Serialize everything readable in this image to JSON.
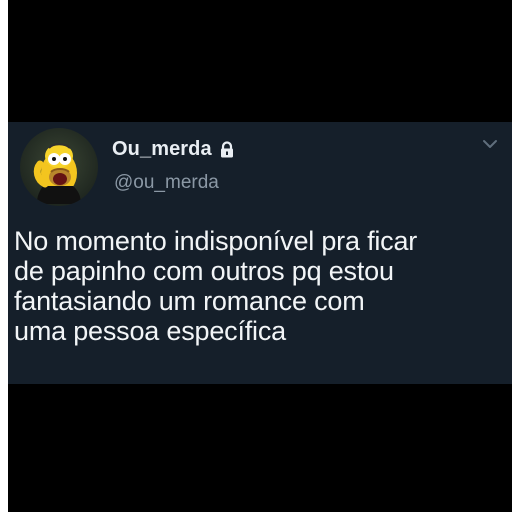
{
  "tweet": {
    "display_name": "Ou_merda",
    "handle": "@ou_merda",
    "avatar_icon": "cartoon-avatar-icon",
    "lock_icon": "lock-icon",
    "menu_icon": "chevron-down-icon",
    "text_lines": [
      "No momento indisponível pra ficar",
      "de papinho com outros pq estou",
      "fantasiando um romance com",
      "uma pessoa específica"
    ]
  },
  "colors": {
    "background": "#000000",
    "card": "#151f2a",
    "primary_text": "#f2f5f7",
    "secondary_text": "#8b98a5"
  }
}
